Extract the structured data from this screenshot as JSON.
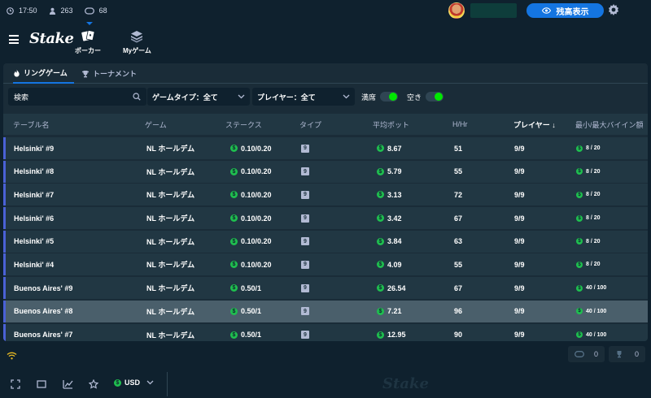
{
  "status": {
    "time": "17:50",
    "users": "263",
    "tables": "68"
  },
  "header": {
    "balance_button": "残高表示"
  },
  "nav": {
    "logo": "Stake",
    "tabs": [
      {
        "label": "ポーカー"
      },
      {
        "label": "Myゲーム"
      }
    ]
  },
  "subtabs": [
    {
      "label": "リングゲーム"
    },
    {
      "label": "トーナメント"
    }
  ],
  "filters": {
    "search_placeholder": "検索",
    "game_type": "ゲームタイプ：全て",
    "players": "プレイヤー：全て",
    "toggle_full": "満席",
    "toggle_empty": "空き"
  },
  "table": {
    "columns": [
      "テーブル名",
      "ゲーム",
      "ステークス",
      "タイプ",
      "平均ポット",
      "H/Hr",
      "プレイヤー ↓",
      "最小/最大バイイン額"
    ],
    "rows": [
      {
        "name": "Helsinki' #9",
        "game": "NL ホールデム",
        "stakes": "0.10/0.20",
        "type": "9",
        "avg_pot": "8.67",
        "hhr": "51",
        "players": "9/9",
        "buyin": "8 / 20"
      },
      {
        "name": "Helsinki' #8",
        "game": "NL ホールデム",
        "stakes": "0.10/0.20",
        "type": "9",
        "avg_pot": "5.79",
        "hhr": "55",
        "players": "9/9",
        "buyin": "8 / 20"
      },
      {
        "name": "Helsinki' #7",
        "game": "NL ホールデム",
        "stakes": "0.10/0.20",
        "type": "9",
        "avg_pot": "3.13",
        "hhr": "72",
        "players": "9/9",
        "buyin": "8 / 20"
      },
      {
        "name": "Helsinki' #6",
        "game": "NL ホールデム",
        "stakes": "0.10/0.20",
        "type": "9",
        "avg_pot": "3.42",
        "hhr": "67",
        "players": "9/9",
        "buyin": "8 / 20"
      },
      {
        "name": "Helsinki' #5",
        "game": "NL ホールデム",
        "stakes": "0.10/0.20",
        "type": "9",
        "avg_pot": "3.84",
        "hhr": "63",
        "players": "9/9",
        "buyin": "8 / 20"
      },
      {
        "name": "Helsinki' #4",
        "game": "NL ホールデム",
        "stakes": "0.10/0.20",
        "type": "9",
        "avg_pot": "4.09",
        "hhr": "55",
        "players": "9/9",
        "buyin": "8 / 20"
      },
      {
        "name": "Buenos Aires' #9",
        "game": "NL ホールデム",
        "stakes": "0.50/1",
        "type": "9",
        "avg_pot": "26.54",
        "hhr": "67",
        "players": "9/9",
        "buyin": "40 / 100"
      },
      {
        "name": "Buenos Aires' #8",
        "game": "NL ホールデム",
        "stakes": "0.50/1",
        "type": "9",
        "avg_pot": "7.21",
        "hhr": "96",
        "players": "9/9",
        "buyin": "40 / 100"
      },
      {
        "name": "Buenos Aires' #7",
        "game": "NL ホールデム",
        "stakes": "0.50/1",
        "type": "9",
        "avg_pot": "12.95",
        "hhr": "90",
        "players": "9/9",
        "buyin": "40 / 100"
      }
    ]
  },
  "counters": {
    "tables_open": "0",
    "tournaments_open": "0"
  },
  "footer": {
    "currency": "USD",
    "watermark": "Stake"
  },
  "colors": {
    "background": "#0f212e",
    "panel": "#1a2c38",
    "row": "#213743",
    "row_selected": "#4a5f6b",
    "accent": "#1475e1",
    "row_border": "#4a61d6",
    "toggle_on": "#00e701",
    "coin": "#1fbf4f"
  }
}
